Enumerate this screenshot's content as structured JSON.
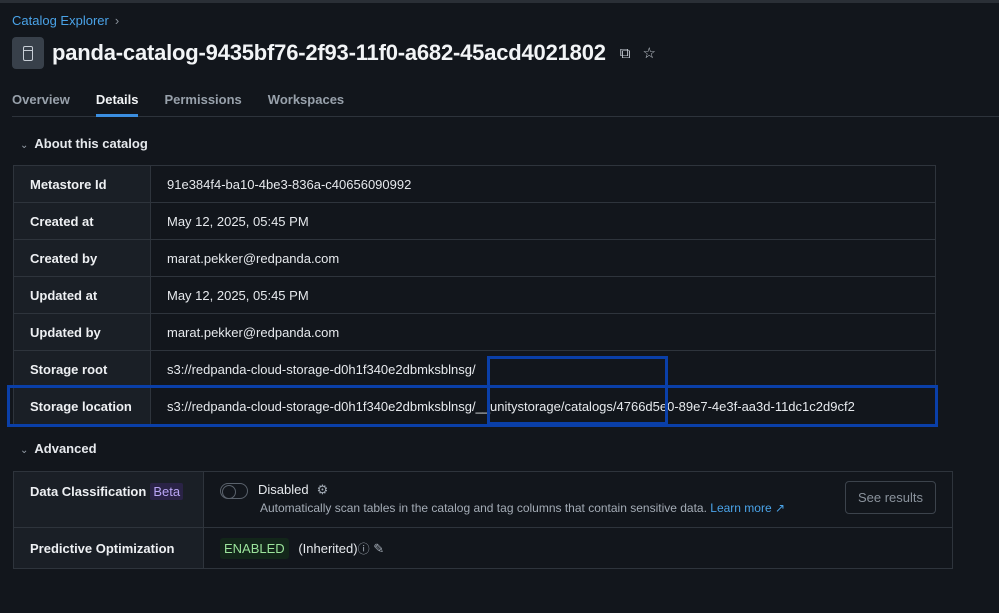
{
  "breadcrumb": {
    "root": "Catalog Explorer",
    "sep": "›"
  },
  "title": "panda-catalog-9435bf76-2f93-11f0-a682-45acd4021802",
  "tabs": [
    "Overview",
    "Details",
    "Permissions",
    "Workspaces"
  ],
  "about": {
    "heading": "About this catalog",
    "rows": [
      {
        "k": "Metastore Id",
        "v": "91e384f4-ba10-4be3-836a-c40656090992"
      },
      {
        "k": "Created at",
        "v": "May 12, 2025, 05:45 PM"
      },
      {
        "k": "Created by",
        "v": "marat.pekker@redpanda.com"
      },
      {
        "k": "Updated at",
        "v": "May 12, 2025, 05:45 PM"
      },
      {
        "k": "Updated by",
        "v": "marat.pekker@redpanda.com"
      },
      {
        "k": "Storage root",
        "v": "s3://redpanda-cloud-storage-d0h1f340e2dbmksblnsg/"
      },
      {
        "k": "Storage location",
        "v": "s3://redpanda-cloud-storage-d0h1f340e2dbmksblnsg/__unitystorage/catalogs/4766d5e0-89e7-4e3f-aa3d-11dc1c2d9cf2"
      }
    ]
  },
  "advanced": {
    "heading": "Advanced",
    "classification": {
      "label": "Data Classification",
      "badge": "Beta",
      "status": "Disabled",
      "desc": "Automatically scan tables in the catalog and tag columns that contain sensitive data.",
      "learn": "Learn more",
      "button": "See results"
    },
    "optimization": {
      "label": "Predictive Optimization",
      "status": "ENABLED",
      "note": "(Inherited)"
    }
  }
}
